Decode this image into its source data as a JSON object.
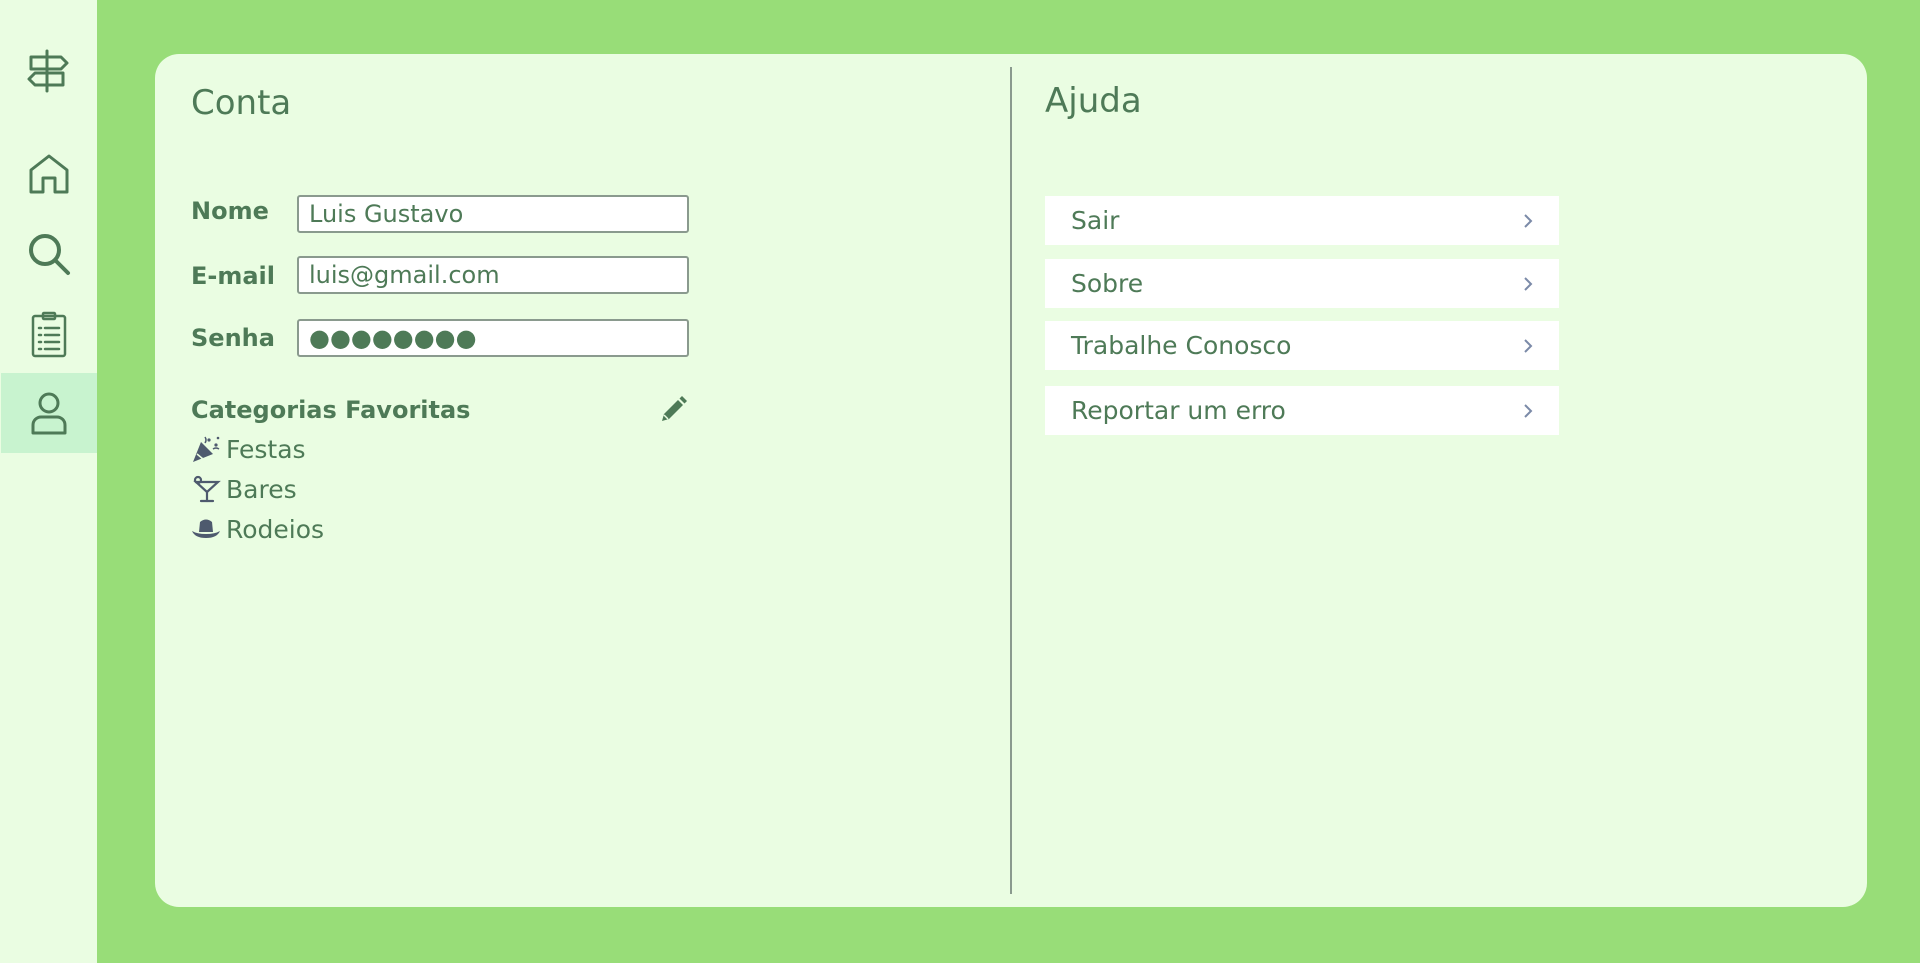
{
  "sidebar": {
    "items": [
      {
        "icon": "signpost-icon"
      },
      {
        "icon": "home-icon"
      },
      {
        "icon": "search-icon"
      },
      {
        "icon": "clipboard-list-icon"
      },
      {
        "icon": "user-icon",
        "active": true
      }
    ]
  },
  "account": {
    "title": "Conta",
    "name_label": "Nome",
    "name_value": "Luis Gustavo",
    "email_label": "E-mail",
    "email_value": "luis@gmail.com",
    "password_label": "Senha",
    "password_value": "●●●●●●●●",
    "favorites_title": "Categorias Favoritas",
    "favorites": [
      {
        "icon": "party-popper-icon",
        "label": "Festas"
      },
      {
        "icon": "cocktail-icon",
        "label": "Bares"
      },
      {
        "icon": "cowboy-hat-icon",
        "label": "Rodeios"
      }
    ]
  },
  "help": {
    "title": "Ajuda",
    "items": [
      {
        "label": "Sair"
      },
      {
        "label": "Sobre"
      },
      {
        "label": "Trabalhe Conosco"
      },
      {
        "label": "Reportar um erro"
      }
    ]
  },
  "colors": {
    "background": "#98dd78",
    "panel": "#eafde2",
    "active_nav": "#c8f3cf",
    "text": "#4e7a57",
    "chevron": "#7b8aa8"
  }
}
